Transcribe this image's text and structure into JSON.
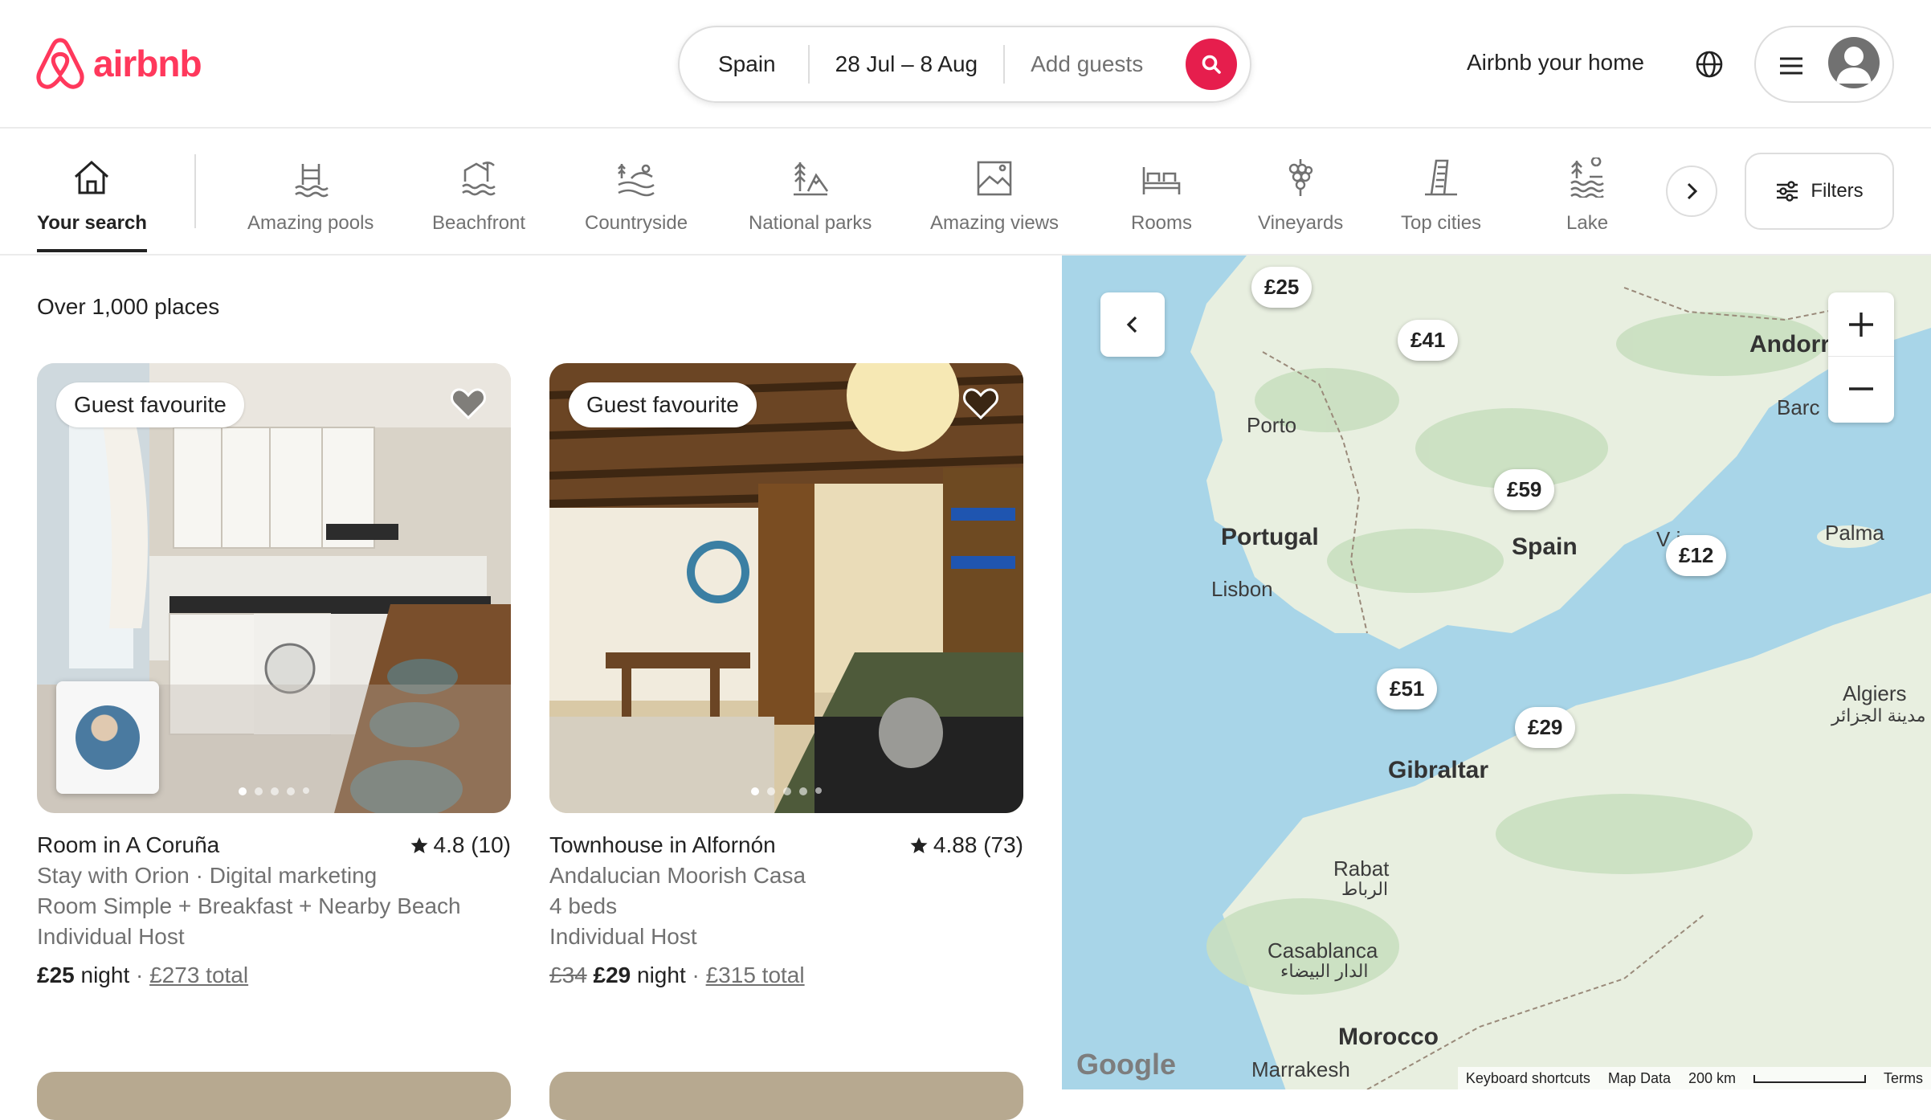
{
  "brand": {
    "name": "airbnb",
    "color": "#FF385C"
  },
  "search": {
    "location": "Spain",
    "dates": "28 Jul – 8 Aug",
    "guests_placeholder": "Add guests",
    "button_color": "#E61E4D"
  },
  "header": {
    "host_link": "Airbnb your home"
  },
  "categories": [
    {
      "label": "Your search",
      "icon": "home-icon",
      "active": true
    },
    {
      "label": "Amazing pools",
      "icon": "pool-icon"
    },
    {
      "label": "Beachfront",
      "icon": "beachfront-icon"
    },
    {
      "label": "Countryside",
      "icon": "countryside-icon"
    },
    {
      "label": "National parks",
      "icon": "national-park-icon"
    },
    {
      "label": "Amazing views",
      "icon": "views-icon"
    },
    {
      "label": "Rooms",
      "icon": "bed-icon"
    },
    {
      "label": "Vineyards",
      "icon": "grapes-icon"
    },
    {
      "label": "Top cities",
      "icon": "city-icon"
    },
    {
      "label": "Lake",
      "icon": "lake-icon"
    }
  ],
  "filters_label": "Filters",
  "results": {
    "count_text": "Over 1,000 places"
  },
  "listings": [
    {
      "badge": "Guest favourite",
      "title": "Room in A Coruña",
      "rating": "4.8 (10)",
      "line1": "Stay with Orion · Digital marketing",
      "line2": "Room Simple + Breakfast + Nearby Beach",
      "line3": "Individual Host",
      "price_old": "",
      "price": "£25",
      "night": "night",
      "sep": "·",
      "total": "£273 total"
    },
    {
      "badge": "Guest favourite",
      "title": "Townhouse in Alfornón",
      "rating": "4.88 (73)",
      "line1": "Andalucian Moorish Casa",
      "line2": "4 beds",
      "line3": "Individual Host",
      "price_old": "£34",
      "price": "£29",
      "night": "night",
      "sep": "·",
      "total": "£315 total"
    }
  ],
  "map": {
    "labels": {
      "porto": "Porto",
      "portugal": "Portugal",
      "lisbon": "Lisbon",
      "spain": "Spain",
      "andorra": "Andorr",
      "barcelona": "Barc",
      "palma": "Palma",
      "valencia": "V     ia",
      "gibraltar": "Gibraltar",
      "algiers": "Algiers",
      "algiers_ar": "مدينة الجزائر",
      "rabat": "Rabat",
      "rabat_ar": "الرباط",
      "casablanca": "Casablanca",
      "casablanca_ar": "الدار البيضاء",
      "morocco": "Morocco",
      "marrakesh": "Marrakesh"
    },
    "pins": {
      "p25": "£25",
      "p41": "£41",
      "p59": "£59",
      "p12": "£12",
      "p51": "£51",
      "p29": "£29"
    },
    "google": "Google",
    "attribution": {
      "shortcuts": "Keyboard shortcuts",
      "data": "Map Data",
      "scale": "200 km",
      "terms": "Terms"
    },
    "sea_color": "#a8d5e8",
    "land_color": "#e8efe0"
  }
}
